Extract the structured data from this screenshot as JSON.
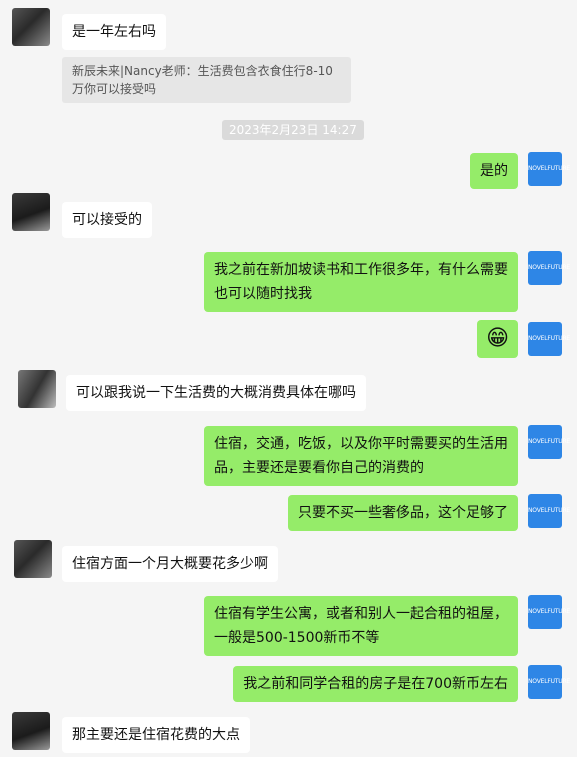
{
  "messages": {
    "m1": "是一年左右吗",
    "quote1": "新辰未来|Nancy老师：生活费包含衣食住行8-10万你可以接受吗",
    "timestamp": "2023年2月23日 14:27",
    "m2": "是的",
    "m3": "可以接受的",
    "m4": "我之前在新加坡读书和工作很多年，有什么需要也可以随时找我",
    "m5": "😁",
    "m6": "可以跟我说一下生活费的大概消费具体在哪吗",
    "m7": "住宿，交通，吃饭，以及你平时需要买的生活用品，主要还是要看你自己的消费的",
    "m8": "只要不买一些奢侈品，这个足够了",
    "m9": "住宿方面一个月大概要花多少啊",
    "m10": "住宿有学生公寓，或者和别人一起合租的祖屋，一般是500-1500新币不等",
    "m11": "我之前和同学合租的房子是在700新币左右",
    "m12": "那主要还是住宿花费的大点"
  },
  "avatar_right_label": "NOVELFUTURE",
  "colors": {
    "sent_bubble": "#95ec69",
    "received_bubble": "#ffffff",
    "background": "#f5f5f5"
  }
}
